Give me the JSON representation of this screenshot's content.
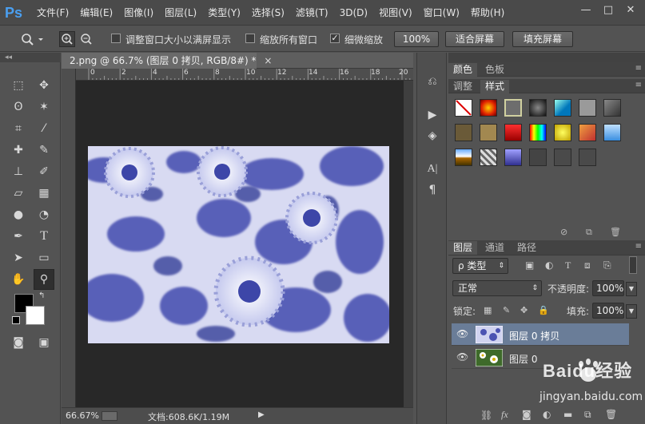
{
  "menubar": {
    "logo": "Ps",
    "items": [
      "文件(F)",
      "编辑(E)",
      "图像(I)",
      "图层(L)",
      "类型(Y)",
      "选择(S)",
      "滤镜(T)",
      "3D(D)",
      "视图(V)",
      "窗口(W)",
      "帮助(H)"
    ],
    "window_buttons": [
      "—",
      "□",
      "✕"
    ]
  },
  "options_bar": {
    "resize_windows_label": "调整窗口大小以满屏显示",
    "zoom_all_label": "缩放所有窗口",
    "scrubby_zoom_label": "细微缩放",
    "zoom_100_label": "100%",
    "fit_screen_label": "适合屏幕",
    "fill_screen_label": "填充屏幕"
  },
  "document": {
    "tab_title": "2.png @ 66.7% (图层 0 拷贝, RGB/8#) *",
    "close_glyph": "×",
    "ruler_ticks": [
      "0",
      "2",
      "4",
      "6",
      "8",
      "10",
      "12",
      "14",
      "16",
      "18",
      "20"
    ],
    "zoom": "66.67%",
    "doc_info": "文档:608.6K/1.19M"
  },
  "panels": {
    "color_tabs": [
      "颜色",
      "色板"
    ],
    "adjust_tabs": [
      "调整",
      "样式"
    ],
    "layer_tabs": [
      "图层",
      "通道",
      "路径"
    ],
    "filter_type": "ρ 类型",
    "blend_mode": "正常",
    "opacity_label": "不透明度:",
    "opacity_value": "100%",
    "lock_label": "锁定:",
    "fill_label": "填充:",
    "fill_value": "100%",
    "layers": [
      {
        "name": "图层 0 拷贝",
        "selected": true
      },
      {
        "name": "图层 0",
        "selected": false
      }
    ]
  },
  "watermark": {
    "brand": "Baidu经验",
    "url": "jingyan.baidu.com"
  }
}
